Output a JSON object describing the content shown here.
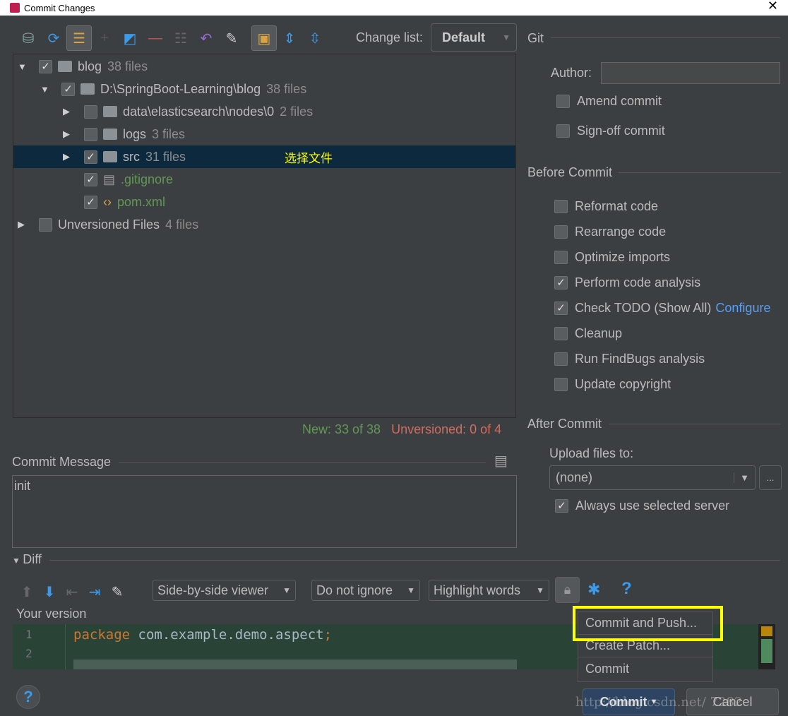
{
  "window": {
    "title": "Commit Changes",
    "close": "✕"
  },
  "toolbar": {
    "change_list_label": "Change list:",
    "change_list_value": "Default"
  },
  "tree": {
    "rows": [
      {
        "name": "blog",
        "count": "38 files"
      },
      {
        "name": "D:\\SpringBoot-Learning\\blog",
        "count": "38 files"
      },
      {
        "name": "data\\elasticsearch\\nodes\\0",
        "count": "2 files"
      },
      {
        "name": "logs",
        "count": "3 files"
      },
      {
        "name": "src",
        "count": "31 files"
      },
      {
        "name": ".gitignore",
        "count": ""
      },
      {
        "name": "pom.xml",
        "count": ""
      },
      {
        "name": "Unversioned Files",
        "count": "4 files"
      }
    ],
    "annotation": "选择文件"
  },
  "status": {
    "new": "New: 33 of 38",
    "unversioned": "Unversioned: 0 of 4"
  },
  "commit_message": {
    "label": "Commit Message",
    "value": "init"
  },
  "git": {
    "title": "Git",
    "author_label": "Author:",
    "author_value": "",
    "amend": "Amend commit",
    "signoff": "Sign-off commit"
  },
  "before_commit": {
    "title": "Before Commit",
    "options": [
      {
        "label": "Reformat code",
        "checked": false
      },
      {
        "label": "Rearrange code",
        "checked": false
      },
      {
        "label": "Optimize imports",
        "checked": false
      },
      {
        "label": "Perform code analysis",
        "checked": true
      },
      {
        "label": "Check TODO (Show All)",
        "checked": true
      },
      {
        "label": "Cleanup",
        "checked": false
      },
      {
        "label": "Run FindBugs analysis",
        "checked": false
      },
      {
        "label": "Update copyright",
        "checked": false
      }
    ],
    "configure_link": "Configure"
  },
  "after_commit": {
    "title": "After Commit",
    "upload_label": "Upload files to:",
    "upload_value": "(none)",
    "browse": "...",
    "always_use": "Always use selected server"
  },
  "diff": {
    "title": "Diff",
    "viewer": "Side-by-side viewer",
    "ignore": "Do not ignore",
    "highlight": "Highlight words",
    "help": "?",
    "your_version": "Your version",
    "lines": [
      {
        "num": "1",
        "keyword": "package",
        "code": " com.example.demo.aspect",
        "semi": ";"
      },
      {
        "num": "2"
      }
    ]
  },
  "popup": {
    "items": [
      "Commit and Push...",
      "Create Patch...",
      "Commit"
    ]
  },
  "buttons": {
    "commit": "Commit",
    "cancel": "Cancel",
    "help": "?"
  },
  "watermark": "http://blog.csdn.net/ 7282",
  "colors": {
    "highlight_box": "#ffff00",
    "selected_row": "#0d293e",
    "new": "#629755",
    "unversioned": "#d36b5f"
  }
}
